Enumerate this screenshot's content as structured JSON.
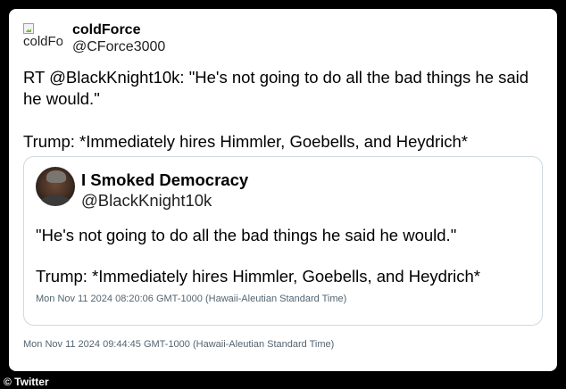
{
  "tweet": {
    "author": {
      "avatar_alt": "coldForce",
      "name": "coldForce",
      "handle": "@CForce3000"
    },
    "text_line1": "RT @BlackKnight10k: \"He's not going to do all the bad things he said he would.\"",
    "text_line2": "Trump: *Immediately hires Himmler, Goebells, and Heydrich*",
    "timestamp": "Mon Nov 11 2024 09:44:45 GMT-1000 (Hawaii-Aleutian Standard Time)"
  },
  "quoted": {
    "name": "I Smoked Democracy",
    "handle": "@BlackKnight10k",
    "text_line1": "\"He's not going to do all the bad things he said he would.\"",
    "text_line2": "Trump: *Immediately hires Himmler, Goebells, and Heydrich*",
    "timestamp": "Mon Nov 11 2024 08:20:06 GMT-1000 (Hawaii-Aleutian Standard Time)"
  },
  "credit": "© Twitter",
  "colors": {
    "background": "#000000",
    "card": "#ffffff",
    "border": "#cfd9de",
    "muted_text": "#536471"
  }
}
